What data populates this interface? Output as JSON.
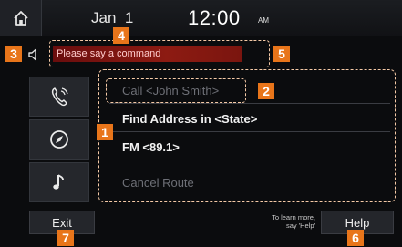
{
  "status_bar": {
    "date": "Jan  1",
    "time": "12:00",
    "ampm": "AM"
  },
  "prompt": {
    "text": "Please say a command"
  },
  "commands": [
    {
      "label": "Call <John Smith>",
      "state": "dim"
    },
    {
      "label": "Find Address in <State>",
      "state": "bright"
    },
    {
      "label": "FM <89.1>",
      "state": "bright"
    },
    {
      "label": "Cancel Route",
      "state": "dim"
    }
  ],
  "side_buttons": [
    {
      "icon": "phone-icon"
    },
    {
      "icon": "navigation-icon"
    },
    {
      "icon": "music-note-icon"
    }
  ],
  "footer": {
    "exit_label": "Exit",
    "help_label": "Help",
    "hint_line1": "To learn more,",
    "hint_line2": "say 'Help'"
  },
  "callouts": [
    "1",
    "2",
    "3",
    "4",
    "5",
    "6",
    "7"
  ],
  "colors": {
    "callout": "#e8751a",
    "prompt_bar": "#8d1b12",
    "outline": "#f4c9a6"
  }
}
